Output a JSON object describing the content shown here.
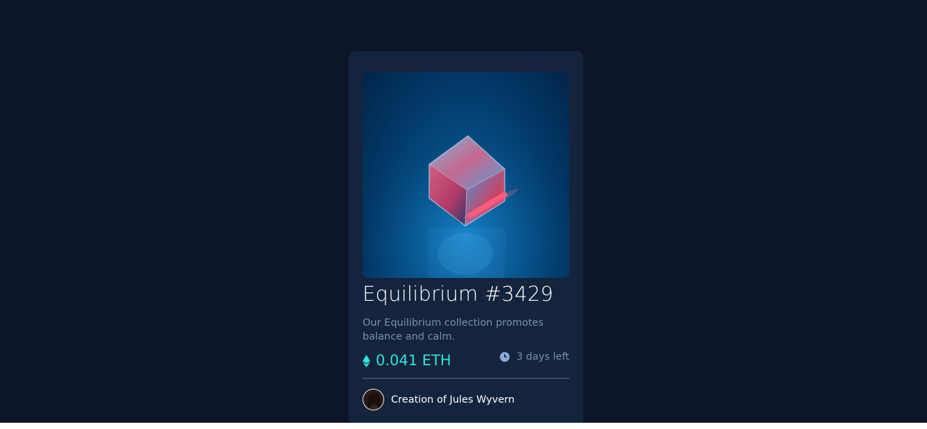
{
  "card": {
    "title": "Equilibrium #3429",
    "description": "Our Equilibrium collection promotes balance and calm.",
    "price": "0.041 ETH",
    "time_left": "3 days left",
    "creator_text": "Creation of Jules Wyvern"
  },
  "colors": {
    "page_background": "#0d1629",
    "card_background": "#15243d",
    "accent_cyan": "#2fe4dc",
    "muted_text": "#7c8ea8",
    "white": "#ffffff"
  },
  "icons": {
    "price": "ethereum-icon",
    "time": "clock-icon"
  }
}
